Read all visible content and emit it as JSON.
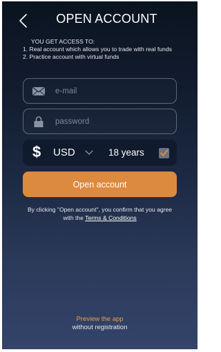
{
  "header": {
    "title": "OPEN ACCOUNT",
    "back_icon": "chevron-left-icon"
  },
  "access": {
    "heading": "YOU GET ACCESS TO:",
    "items": [
      "1. Real account which allows you to trade with real funds",
      "2. Practice account with virtual funds"
    ]
  },
  "form": {
    "email": {
      "placeholder": "e-mail",
      "value": "",
      "icon": "envelope-icon"
    },
    "password": {
      "placeholder": "password",
      "value": "",
      "icon": "lock-icon"
    },
    "currency": {
      "symbol": "$",
      "selected": "USD",
      "icon": "chevron-down-icon"
    },
    "age": {
      "label": "18 years",
      "checked": true
    },
    "submit_label": "Open account"
  },
  "consent": {
    "before": "By clicking \"Open account\", you confirm that you agree with the ",
    "terms_link": "Terms & Conditions"
  },
  "preview": {
    "link": "Preview the app",
    "sub": "without registration"
  },
  "colors": {
    "accent": "#dc8a40",
    "preview_link": "#e9a04f",
    "background_top": "#0a1420",
    "background_bottom": "#34446a"
  }
}
